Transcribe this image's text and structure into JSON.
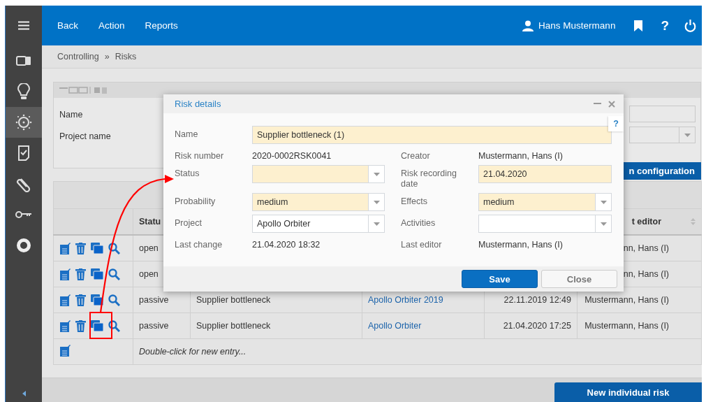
{
  "topbar": {
    "menu": [
      {
        "label": "Back"
      },
      {
        "label": "Action"
      },
      {
        "label": "Reports"
      }
    ],
    "user": "Hans Mustermann",
    "help": "?"
  },
  "sidebar": {
    "items": [
      {
        "kind": "cards",
        "selected": false
      },
      {
        "kind": "bulb",
        "selected": false
      },
      {
        "kind": "sun",
        "selected": true
      },
      {
        "kind": "checklist",
        "selected": false
      },
      {
        "kind": "clip",
        "selected": false
      },
      {
        "kind": "key",
        "selected": false
      },
      {
        "kind": "lifebuoy",
        "selected": false
      }
    ]
  },
  "breadcrumb": {
    "items": [
      "Controlling",
      "Risks"
    ],
    "separator": "»"
  },
  "filter": {
    "labels": [
      "Name",
      "Project name"
    ],
    "extra_fields": [
      {
        "kind": "text"
      },
      {
        "kind": "select"
      }
    ],
    "config_button": "n configuration"
  },
  "table": {
    "status_header": "Statu",
    "last_editor_header": "t editor",
    "rows": [
      {
        "status": "open",
        "last_editor": "nn, Hans (I)",
        "highlighted": false
      },
      {
        "status": "open",
        "last_editor": "nn, Hans (I)",
        "highlighted": false
      },
      {
        "status": "passive",
        "name": "Supplier bottleneck",
        "project": "Apollo Orbiter 2019",
        "last_change": "22.11.2019 12:49",
        "last_editor": "Mustermann, Hans (I)",
        "highlighted": false
      },
      {
        "status": "passive",
        "name": "Supplier bottleneck",
        "project": "Apollo Orbiter",
        "last_change": "21.04.2020 17:25",
        "last_editor": "Mustermann, Hans (I)",
        "highlighted": true
      }
    ],
    "new_entry": "Double-click for new entry..."
  },
  "dialog": {
    "title": "Risk details",
    "help": "?",
    "rows": [
      [
        {
          "label": "Name",
          "kind": "input",
          "value": "Supplier bottleneck (1)",
          "required": true
        }
      ],
      [
        {
          "label": "Risk number",
          "kind": "text",
          "value": "2020-0002RSK0041"
        },
        {
          "label": "Creator",
          "kind": "text",
          "value": "Mustermann, Hans (I)"
        }
      ],
      [
        {
          "label": "Status",
          "kind": "select",
          "required": true
        },
        {
          "label": "Risk recording date",
          "kind": "input",
          "value": "21.04.2020",
          "required": true
        }
      ],
      [
        {
          "label": "Probability",
          "kind": "select",
          "value": "medium",
          "required": true
        },
        {
          "label": "Effects",
          "kind": "select",
          "value": "medium",
          "required": true
        }
      ],
      [
        {
          "label": "Project",
          "kind": "select",
          "value": "Apollo Orbiter",
          "required": false
        },
        {
          "label": "Activities",
          "kind": "select",
          "required": false
        }
      ],
      [
        {
          "label": "Last change",
          "kind": "text",
          "value": "21.04.2020 18:32"
        },
        {
          "label": "Last editor",
          "kind": "text",
          "value": "Mustermann, Hans (I)"
        }
      ]
    ],
    "buttons": [
      {
        "label": "Save",
        "primary": true
      },
      {
        "label": "Close",
        "primary": false
      }
    ]
  },
  "footer": {
    "button": "New individual risk"
  }
}
